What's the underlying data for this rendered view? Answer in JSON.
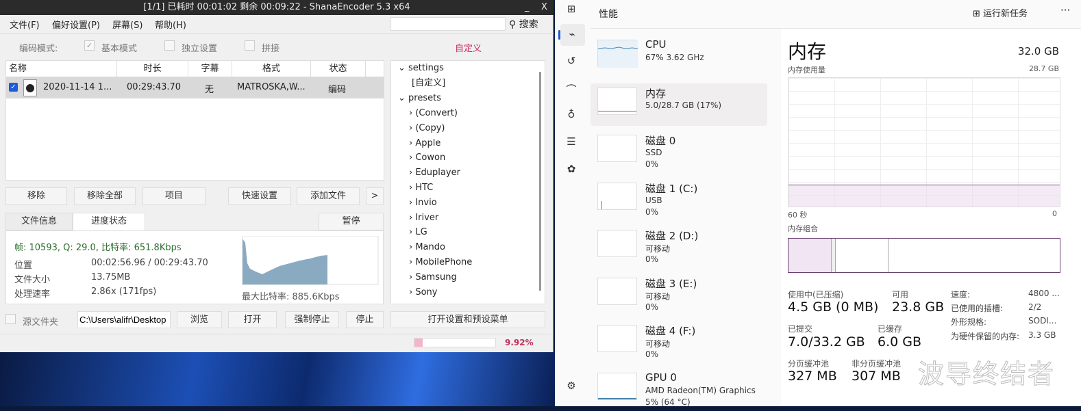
{
  "shana": {
    "title": "[1/1] 已耗时 00:01:02  剩余 00:09:22 - ShanaEncoder 5.3 x64",
    "min": "_",
    "close": "X",
    "menu": [
      "文件(F)",
      "偏好设置(P)",
      "屏幕(S)",
      "帮助(H)"
    ],
    "search_label": "搜索",
    "search_value": "",
    "mode_label": "编码模式:",
    "mode_basic": "基本模式",
    "mode_independent": "独立设置",
    "mode_join": "拼接",
    "custom": "自定义",
    "columns": [
      "名称",
      "时长",
      "字幕",
      "格式",
      "状态"
    ],
    "rows": [
      {
        "name": "2020-11-14 1...",
        "duration": "00:29:43.70",
        "subtitle": "无",
        "format": "MATROSKA,W...",
        "status": "编码",
        "checked": true
      }
    ],
    "buttons": {
      "remove": "移除",
      "remove_all": "移除全部",
      "item": "项目",
      "quick": "快速设置",
      "add_file": "添加文件",
      "more": ">"
    },
    "tabs": {
      "file_info": "文件信息",
      "progress": "进度状态",
      "pause": "暂停"
    },
    "stats": {
      "line": "帧: 10593, Q: 29.0, 比特率: 651.8Kbps",
      "pos_label": "位置",
      "pos": "00:02:56.96 / 00:29:43.70",
      "size_label": "文件大小",
      "size": "13.75MB",
      "speed_label": "处理速率",
      "speed": "2.86x (171fps)",
      "max_bitrate": "最大比特率: 885.6Kbps"
    },
    "tree": {
      "settings": "settings",
      "custom": "[自定义]",
      "presets": "presets",
      "items": [
        "(Convert)",
        "(Copy)",
        "Apple",
        "Cowon",
        "Eduplayer",
        "HTC",
        "Invio",
        "Iriver",
        "LG",
        "Mando",
        "MobilePhone",
        "Samsung",
        "Sony"
      ]
    },
    "bottom": {
      "source_folder": "源文件夹",
      "path": "C:\\Users\\alifr\\Desktop",
      "browse": "浏览",
      "open": "打开",
      "force_stop": "强制停止",
      "stop": "停止",
      "open_menu": "打开设置和预设菜单"
    },
    "progress_percent": 9.92,
    "progress_text": "9.92%"
  },
  "tm": {
    "header": "性能",
    "run_task": "运行新任务",
    "more": "···",
    "items": [
      {
        "title": "CPU",
        "sub": "67% 3.62 GHz",
        "sub2": ""
      },
      {
        "title": "内存",
        "sub": "5.0/28.7 GB (17%)",
        "sub2": ""
      },
      {
        "title": "磁盘 0",
        "sub": "SSD",
        "sub2": "0%"
      },
      {
        "title": "磁盘 1 (C:)",
        "sub": "USB",
        "sub2": "0%"
      },
      {
        "title": "磁盘 2 (D:)",
        "sub": "可移动",
        "sub2": "0%"
      },
      {
        "title": "磁盘 3 (E:)",
        "sub": "可移动",
        "sub2": "0%"
      },
      {
        "title": "磁盘 4 (F:)",
        "sub": "可移动",
        "sub2": "0%"
      },
      {
        "title": "GPU 0",
        "sub": "AMD Radeon(TM) Graphics",
        "sub2": "5% (64 °C)"
      }
    ],
    "detail": {
      "title": "内存",
      "total": "32.0 GB",
      "usage_label": "内存使用量",
      "usage_max": "28.7 GB",
      "time_left": "60 秒",
      "time_right": "0",
      "composition": "内存组合",
      "usage_fraction": 0.17,
      "in_use_label": "使用中(已压缩)",
      "in_use": "4.5 GB (0 MB)",
      "available_label": "可用",
      "available": "23.8 GB",
      "committed_label": "已提交",
      "committed": "7.0/33.2 GB",
      "cached_label": "已缓存",
      "cached": "6.0 GB",
      "paged_label": "分页缓冲池",
      "paged": "327 MB",
      "nonpaged_label": "非分页缓冲池",
      "nonpaged": "307 MB",
      "speed_label": "速度:",
      "speed": "4800 ...",
      "slots_label": "已使用的插槽:",
      "slots": "2/2",
      "form_label": "外形规格:",
      "form": "SODI...",
      "reserved_label": "为硬件保留的内存:",
      "reserved": "3.3 GB"
    }
  },
  "watermark": "波导终结者"
}
